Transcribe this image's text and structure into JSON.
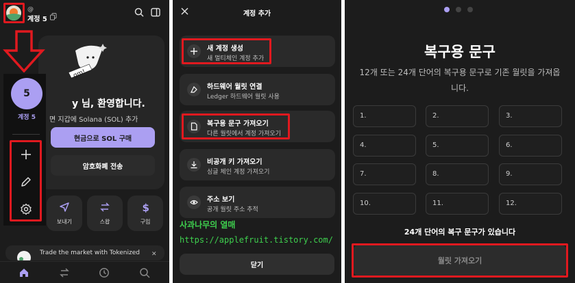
{
  "panel1": {
    "account_at": "@",
    "account_name": "계정 5",
    "welcome_title": "y 님, 환영합니다.",
    "welcome_sub": "면 지갑에 Solana (SOL) 추가",
    "sticker_text": "gm!",
    "buy_button": "현금으로 SOL 구매",
    "send_button": "암호화폐 전송",
    "quick_actions": [
      {
        "label": "보내기",
        "icon": "send-icon"
      },
      {
        "label": "스왑",
        "icon": "swap-icon"
      },
      {
        "label": "구입",
        "icon": "dollar-icon"
      }
    ],
    "promo_text": "Trade the market with Tokenized",
    "promo_close": "✕",
    "sidebar": {
      "account_number": "5",
      "account_label": "계정 5",
      "actions": [
        "add-icon",
        "edit-icon",
        "settings-icon"
      ]
    },
    "nav": [
      "home-icon",
      "swap-icon",
      "history-icon",
      "search-icon"
    ]
  },
  "panel2": {
    "title": "계정 추가",
    "options": [
      {
        "title": "새 계정 생성",
        "sub": "새 멀티체인 계정 추가",
        "icon": "plus-icon"
      },
      {
        "title": "하드웨어 월릿 연결",
        "sub": "Ledger 하드웨어 월릿 사용",
        "icon": "ledger-icon"
      },
      {
        "title": "복구용 문구 가져오기",
        "sub": "다른 월릿에서 계정 가져오기",
        "icon": "document-icon"
      },
      {
        "title": "비공개 키 가져오기",
        "sub": "싱글 체인 계정 가져오기",
        "icon": "download-icon"
      },
      {
        "title": "주소 보기",
        "sub": "공개 월릿 주소 추적",
        "icon": "eye-icon"
      }
    ],
    "watermark_name": "사과나무의 열매",
    "watermark_url": "https://applefruit.tistory.com/",
    "close_button": "닫기"
  },
  "panel3": {
    "title": "복구용 문구",
    "description": "12개 또는 24개 단어의 복구용 문구로 기존 월릿을 가져옵니다.",
    "words": [
      "1.",
      "2.",
      "3.",
      "4.",
      "5.",
      "6.",
      "7.",
      "8.",
      "9.",
      "10.",
      "11.",
      "12."
    ],
    "toggle_text": "24개 단어의 복구 문구가 있습니다",
    "import_button": "월릿 가져오기"
  },
  "colors": {
    "accent": "#ab9ff2",
    "background": "#1c1c1c",
    "highlight": "#e0191f",
    "watermark": "#3ecf4e"
  }
}
